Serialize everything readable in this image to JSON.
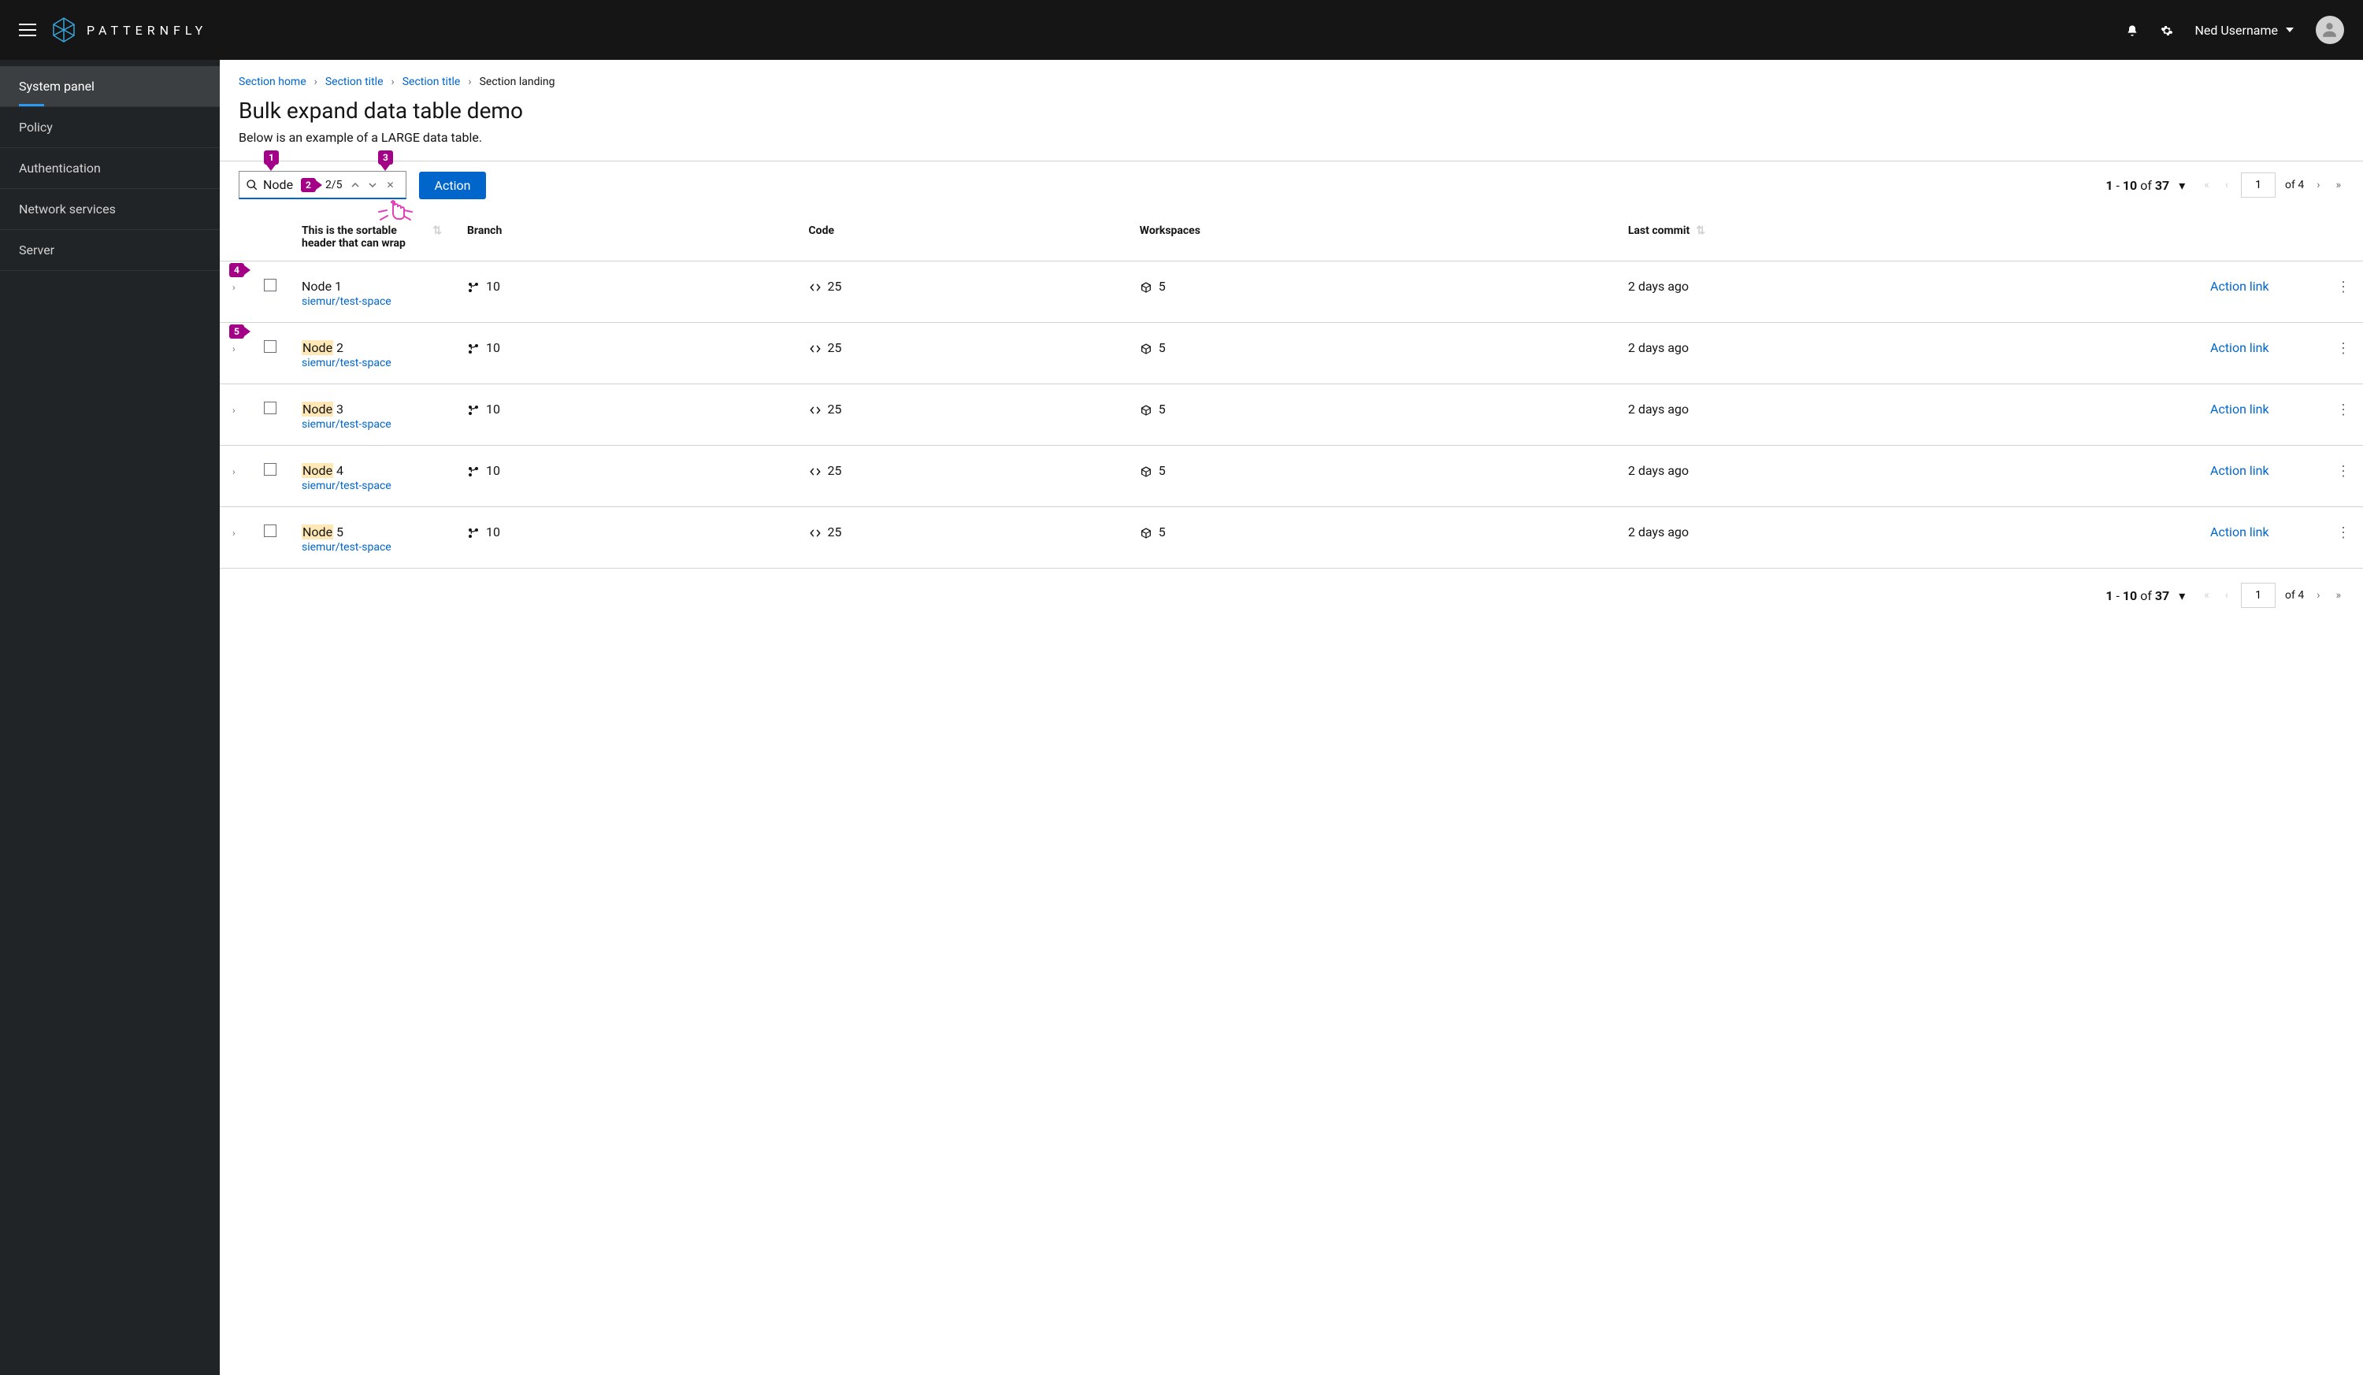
{
  "header": {
    "brand": "PATTERNFLY",
    "user_name": "Ned Username"
  },
  "sidebar": {
    "items": [
      {
        "label": "System panel",
        "active": true
      },
      {
        "label": "Policy"
      },
      {
        "label": "Authentication"
      },
      {
        "label": "Network services"
      },
      {
        "label": "Server"
      }
    ]
  },
  "breadcrumb": {
    "items": [
      "Section home",
      "Section title",
      "Section title"
    ],
    "current": "Section landing"
  },
  "page": {
    "title": "Bulk expand data table demo",
    "description": "Below is an example of a LARGE data table."
  },
  "toolbar": {
    "search_value": "Node",
    "search_counter": "2/5",
    "action_label": "Action"
  },
  "pagination": {
    "range_from": "1",
    "range_to": "10",
    "total": "37",
    "page": "1",
    "pages": "4"
  },
  "annotations": {
    "a1": "1",
    "a2": "2",
    "a3": "3",
    "a4": "4",
    "a5": "5"
  },
  "table": {
    "headers": {
      "name": "This is the sortable header that can wrap",
      "branch": "Branch",
      "code": "Code",
      "workspaces": "Workspaces",
      "last_commit": "Last commit"
    },
    "action_link_label": "Action link",
    "rows": [
      {
        "name_prefix": "Node",
        "name_hl": false,
        "name_num": " 1",
        "sub": "siemur/test-space",
        "branch": "10",
        "code": "25",
        "workspaces": "5",
        "last_commit": "2 days ago"
      },
      {
        "name_prefix": "Node",
        "name_hl": true,
        "name_num": " 2",
        "sub": "siemur/test-space",
        "branch": "10",
        "code": "25",
        "workspaces": "5",
        "last_commit": "2 days ago"
      },
      {
        "name_prefix": "Node",
        "name_hl": true,
        "name_num": " 3",
        "sub": "siemur/test-space",
        "branch": "10",
        "code": "25",
        "workspaces": "5",
        "last_commit": "2 days ago"
      },
      {
        "name_prefix": "Node",
        "name_hl": true,
        "name_num": " 4",
        "sub": "siemur/test-space",
        "branch": "10",
        "code": "25",
        "workspaces": "5",
        "last_commit": "2 days ago"
      },
      {
        "name_prefix": "Node",
        "name_hl": true,
        "name_num": " 5",
        "sub": "siemur/test-space",
        "branch": "10",
        "code": "25",
        "workspaces": "5",
        "last_commit": "2 days ago"
      }
    ]
  }
}
